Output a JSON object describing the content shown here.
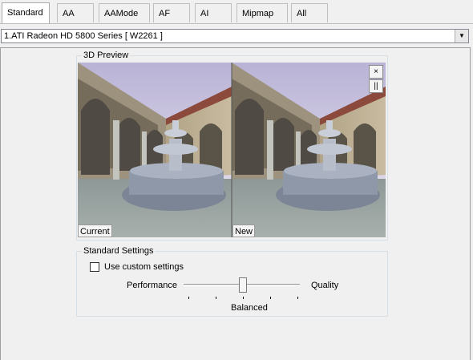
{
  "tabs": [
    {
      "label": "Standard",
      "active": true
    },
    {
      "label": "AA",
      "active": false
    },
    {
      "label": "AAMode",
      "active": false
    },
    {
      "label": "AF",
      "active": false
    },
    {
      "label": "AI",
      "active": false
    },
    {
      "label": "Mipmap",
      "active": false
    },
    {
      "label": "All",
      "active": false
    }
  ],
  "adapter": {
    "selected": "1.ATI Radeon HD 5800 Series [ W2261 ]"
  },
  "preview": {
    "group_label": "3D Preview",
    "current_label": "Current",
    "new_label": "New",
    "close_symbol": "×",
    "pause_symbol": "||"
  },
  "settings": {
    "group_label": "Standard Settings",
    "custom_checkbox": {
      "label": "Use custom settings",
      "checked": false
    },
    "slider": {
      "left_label": "Performance",
      "right_label": "Quality",
      "value_label": "Balanced",
      "value": 0.5
    }
  },
  "colors": {
    "accent_border": "#d5dfe5",
    "window_bg": "#f0f0f0"
  }
}
